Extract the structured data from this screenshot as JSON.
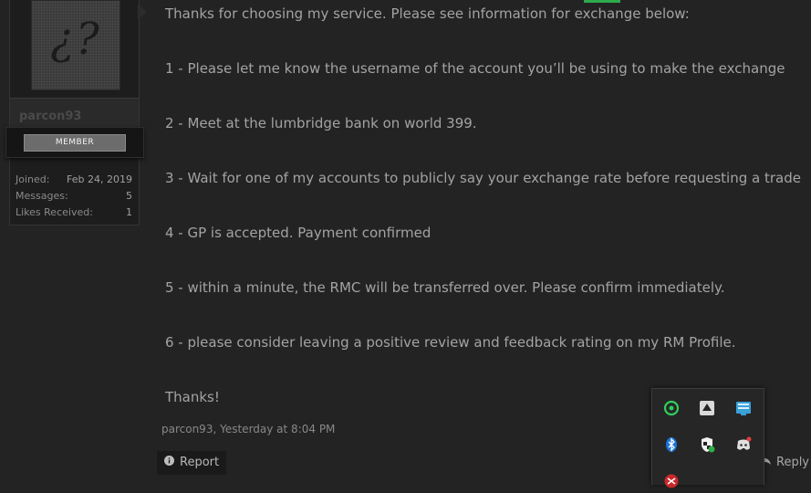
{
  "user": {
    "avatar_placeholder": "¿?",
    "username": "parcon93",
    "role": "MEMBER",
    "stats": [
      {
        "label": "Joined:",
        "value": "Feb 24, 2019"
      },
      {
        "label": "Messages:",
        "value": "5"
      },
      {
        "label": "Likes Received:",
        "value": "1"
      }
    ]
  },
  "message": {
    "lines": [
      "Thanks for choosing my service. Please see information for exchange below:",
      "1 - Please let me know the username of the account you’ll be using to make the exchange",
      "2 - Meet at the lumbridge bank on world 399.",
      "3 - Wait for one of my accounts to publicly say your exchange rate before requesting a trade",
      "4 - GP is accepted. Payment confirmed",
      "5 - within a minute, the RMC will be transferred over. Please confirm immediately.",
      "6 - please consider leaving a positive review and feedback rating on my RM Profile.",
      "Thanks!"
    ]
  },
  "meta": {
    "author": "parcon93",
    "separator": ", ",
    "time": "Yesterday at 8:04 PM"
  },
  "actions": {
    "report_label": "Report",
    "reply_label": "Reply"
  },
  "tray": {
    "icons": [
      "razer-cortex-icon",
      "gog-galaxy-icon",
      "network-monitor-icon",
      "bluetooth-icon",
      "security-shield-icon",
      "discord-icon",
      "red-app-icon"
    ]
  },
  "colors": {
    "accent_green": "#2eaa4d",
    "background": "#232323",
    "text": "#a3a3a3"
  }
}
